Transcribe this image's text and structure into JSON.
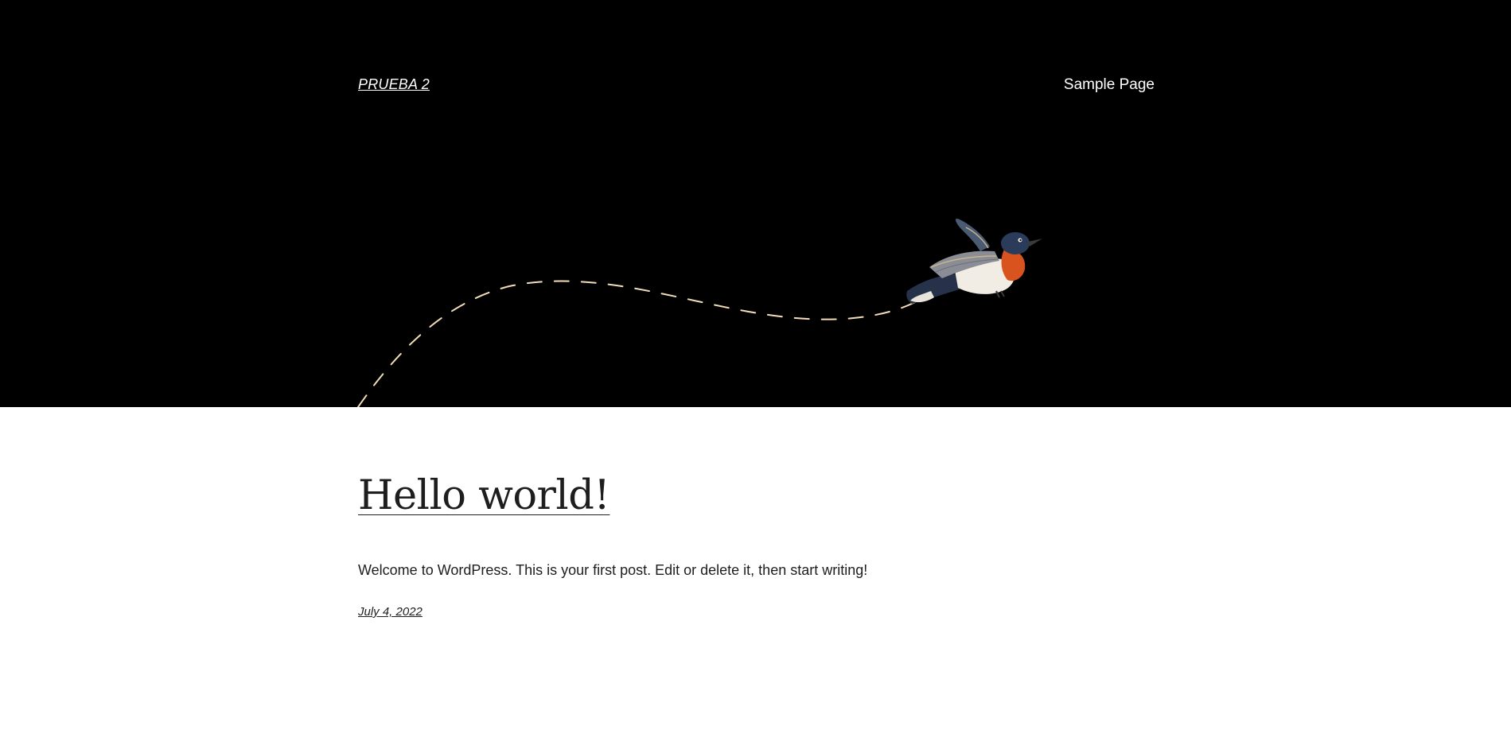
{
  "header": {
    "site_title": "PRUEBA 2",
    "nav": [
      {
        "label": "Sample Page"
      }
    ],
    "background_color": "#000000",
    "illustration": "flying-bird-with-dashed-trail"
  },
  "post": {
    "title": "Hello world!",
    "excerpt": "Welcome to WordPress. This is your first post. Edit or delete it, then start writing!",
    "date": "July 4, 2022"
  },
  "colors": {
    "text": "#1e1e1e",
    "background": "#ffffff",
    "header_text": "#ffffff",
    "trail": "#f2ddb8",
    "bird_breast": "#d9531e",
    "bird_head": "#2b3c5a"
  }
}
